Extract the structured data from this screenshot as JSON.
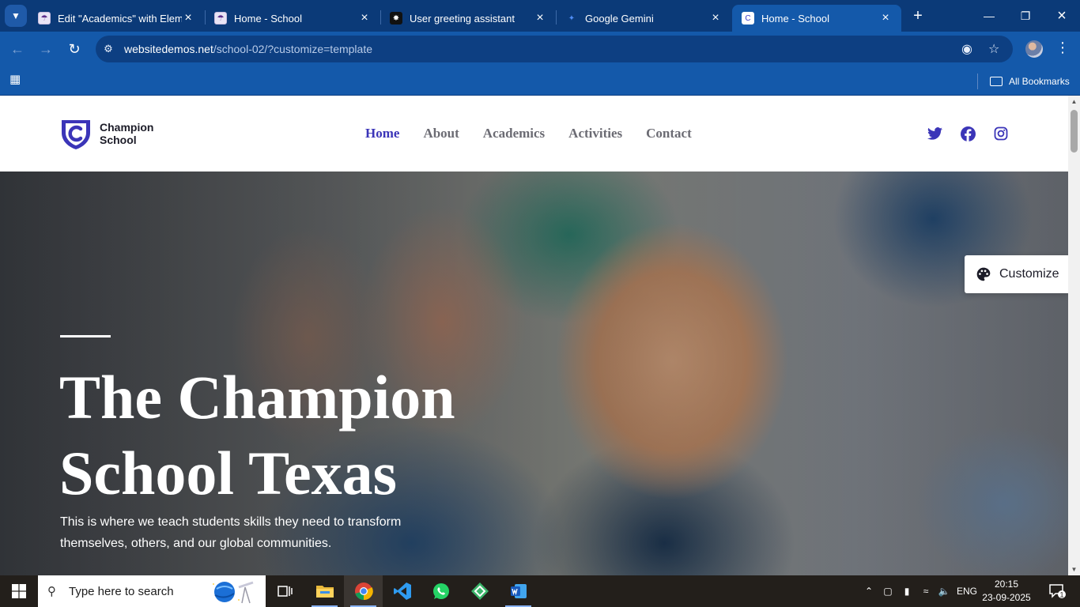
{
  "browser": {
    "tabs": [
      {
        "title": "Edit \"Academics\" with Elementor",
        "favicon": "school-crest-icon"
      },
      {
        "title": "Home - School",
        "favicon": "school-crest-icon"
      },
      {
        "title": "User greeting assistant",
        "favicon": "openai-icon"
      },
      {
        "title": "Google Gemini",
        "favicon": "gemini-icon"
      },
      {
        "title": "Home - School",
        "favicon": "shield-c-icon",
        "active": true
      }
    ],
    "url_domain": "websitedemos.net",
    "url_path": "/school-02/?customize=template",
    "all_bookmarks": "All Bookmarks",
    "accent": "#1459aa"
  },
  "site": {
    "logo_line1": "Champion",
    "logo_line2": "School",
    "nav": [
      "Home",
      "About",
      "Academics",
      "Activities",
      "Contact"
    ],
    "nav_active": "Home",
    "brand_color": "#3b35b8",
    "hero_title_line1": "The Champion",
    "hero_title_line2": "School Texas",
    "hero_subtitle": "This is where we teach students skills they need to transform themselves, others, and our global communities.",
    "customize_label": "Customize"
  },
  "taskbar": {
    "search_placeholder": "Type here to search",
    "language": "ENG",
    "time": "20:15",
    "date": "23-09-2025",
    "notifications": "1"
  }
}
